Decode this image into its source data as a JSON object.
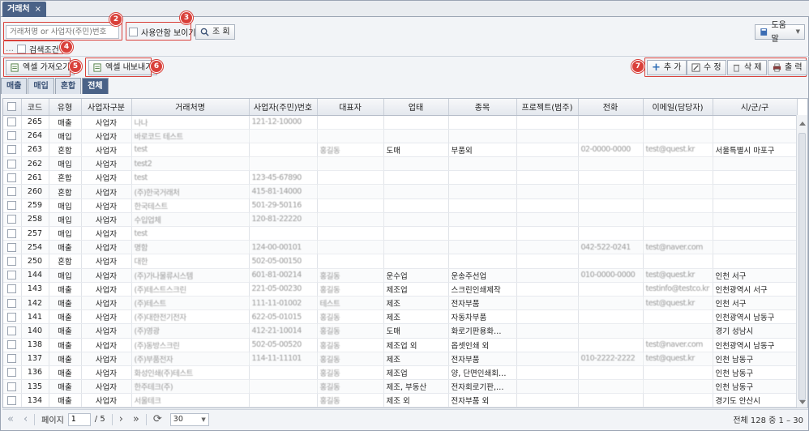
{
  "window": {
    "tab_title": "거래처",
    "tab_close": "×"
  },
  "search": {
    "placeholder": "거래처명 or 사업자(주민)번호",
    "show_unused_label": "사용안함 보이기",
    "search_button": "조 회",
    "conditions_label": "검색조건"
  },
  "help": {
    "label": "도움말"
  },
  "excel": {
    "import_label": "엑셀 가져오기",
    "export_label": "엑셀 내보내기"
  },
  "actions": {
    "add": "추 가",
    "edit": "수 정",
    "delete": "삭 제",
    "print": "출 력"
  },
  "badges": [
    "2",
    "3",
    "4",
    "5",
    "6",
    "7"
  ],
  "subtabs": [
    "매출",
    "매입",
    "혼합",
    "전체"
  ],
  "active_subtab": "전체",
  "columns": [
    "",
    "코드",
    "유형",
    "사업자구분",
    "거래처명",
    "사업자(주민)번호",
    "대표자",
    "업태",
    "종목",
    "프로젝트(범주)",
    "전화",
    "이메일(담당자)",
    "시/군/구"
  ],
  "rows": [
    [
      "265",
      "매출",
      "사업자",
      "나나",
      "121-12-10000",
      "",
      "",
      "",
      "",
      "",
      "",
      ""
    ],
    [
      "264",
      "매입",
      "사업자",
      "바로코드 테스트",
      "",
      "",
      "",
      "",
      "",
      "",
      "",
      ""
    ],
    [
      "263",
      "혼합",
      "사업자",
      "test",
      "",
      "홍길동",
      "도매",
      "부품외",
      "",
      "02-0000-0000",
      "test@quest.kr",
      "서울특별시 마포구"
    ],
    [
      "262",
      "매입",
      "사업자",
      "test2",
      "",
      "",
      "",
      "",
      "",
      "",
      "",
      ""
    ],
    [
      "261",
      "혼합",
      "사업자",
      "test",
      "123-45-67890",
      "",
      "",
      "",
      "",
      "",
      "",
      ""
    ],
    [
      "260",
      "혼합",
      "사업자",
      "(주)한국거래처",
      "415-81-14000",
      "",
      "",
      "",
      "",
      "",
      "",
      ""
    ],
    [
      "259",
      "매입",
      "사업자",
      "한국테스트",
      "501-29-50116",
      "",
      "",
      "",
      "",
      "",
      "",
      ""
    ],
    [
      "258",
      "매입",
      "사업자",
      "수입업체",
      "120-81-22220",
      "",
      "",
      "",
      "",
      "",
      "",
      ""
    ],
    [
      "257",
      "매입",
      "사업자",
      "test",
      "",
      "",
      "",
      "",
      "",
      "",
      "",
      ""
    ],
    [
      "254",
      "매출",
      "사업자",
      "명함",
      "124-00-00101",
      "",
      "",
      "",
      "",
      "042-522-0241",
      "test@naver.com",
      ""
    ],
    [
      "250",
      "혼합",
      "사업자",
      "대한",
      "502-05-00150",
      "",
      "",
      "",
      "",
      "",
      "",
      ""
    ],
    [
      "144",
      "매입",
      "사업자",
      "(주)가나물류시스템",
      "601-81-00214",
      "홍길동",
      "운수업",
      "운송주선업",
      "",
      "010-0000-0000",
      "test@quest.kr",
      "인천 서구"
    ],
    [
      "143",
      "매출",
      "사업자",
      "(주)테스트스크린",
      "221-05-00230",
      "홍길동",
      "제조업",
      "스크린인쇄제작",
      "",
      "",
      "testinfo@testco.kr",
      "인천광역시 서구"
    ],
    [
      "142",
      "매출",
      "사업자",
      "(주)테스트",
      "111-11-01002",
      "테스트",
      "제조",
      "전자부품",
      "",
      "",
      "test@quest.kr",
      "인천 서구"
    ],
    [
      "141",
      "매출",
      "사업자",
      "(주)대한전기전자",
      "622-05-01015",
      "홍길동",
      "제조",
      "자동차부품",
      "",
      "",
      "",
      "인천광역시 남동구"
    ],
    [
      "140",
      "매출",
      "사업자",
      "(주)영광",
      "412-21-10014",
      "홍길동",
      "도매",
      "화로기판용화…",
      "",
      "",
      "",
      "경기 성남시"
    ],
    [
      "138",
      "매출",
      "사업자",
      "(주)동방스크린",
      "502-05-00520",
      "홍길동",
      "제조업 외",
      "옵셋인쇄 외",
      "",
      "",
      "test@naver.com",
      "인천광역시 남동구"
    ],
    [
      "137",
      "매출",
      "사업자",
      "(주)부품전자",
      "114-11-11101",
      "홍길동",
      "제조",
      "전자부품",
      "",
      "010-2222-2222",
      "test@quest.kr",
      "인천 남동구"
    ],
    [
      "136",
      "매출",
      "사업자",
      "화성인쇄(주)테스트",
      "",
      "홍길동",
      "제조업",
      "양, 단면인쇄회…",
      "",
      "",
      "",
      "인천 남동구"
    ],
    [
      "135",
      "매출",
      "사업자",
      "한주테크(주)",
      "",
      "홍길동",
      "제조, 부동산",
      "전자회로기판,…",
      "",
      "",
      "",
      "인천 남동구"
    ],
    [
      "134",
      "매출",
      "사업자",
      "서울테크",
      "",
      "홍길동",
      "제조 외",
      "전자부품 외",
      "",
      "",
      "",
      "경기도 안산시"
    ]
  ],
  "pager": {
    "page_label": "페이지",
    "page_value": "1",
    "total_pages": "/ 5",
    "page_size": "30",
    "summary": "전체 128 중 1 – 30"
  }
}
